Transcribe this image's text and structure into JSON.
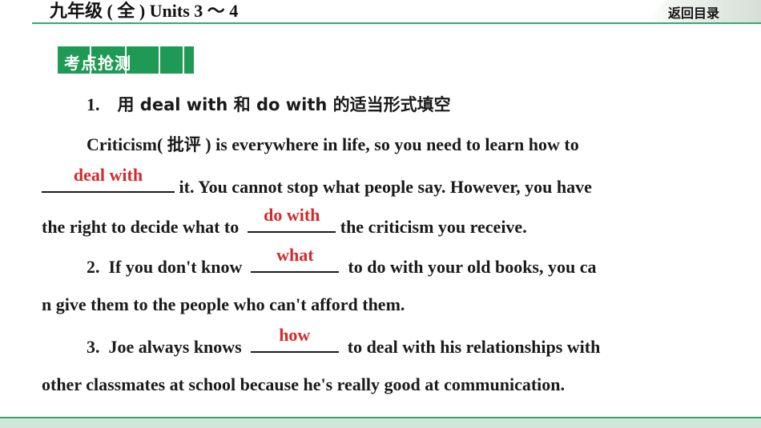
{
  "header": {
    "title": "九年级 ( 全 ) Units 3 ～ 4",
    "back_label": "返回目录"
  },
  "tag": {
    "label": "考点抢测"
  },
  "q1": {
    "number": "1.",
    "instruction": "用 deal with 和 do with 的适当形式填空",
    "l1a": "Criticism( ",
    "l1b": "批评",
    "l1c": " ) is everywhere in life, so you need to learn how to",
    "blank1": "deal with",
    "l2": " it. You cannot stop what people say. However, you have",
    "l3a": "the right to decide what to ",
    "blank2": "do with",
    "l3b": " the criticism you receive."
  },
  "q2": {
    "number": "2.",
    "l1a": "If you don't know ",
    "blank": "what",
    "l1b": " to do with your old books, you ca",
    "l2": "n give them to the people who can't afford them."
  },
  "q3": {
    "number": "3.",
    "l1a": "Joe always knows ",
    "blank": "how",
    "l1b": " to deal with his relationships with",
    "l2": "other classmates  at school because he's really good at communication."
  },
  "colors": {
    "accent": "#1f9a55",
    "answer": "#d42a2a",
    "rule": "#3aa76d"
  }
}
